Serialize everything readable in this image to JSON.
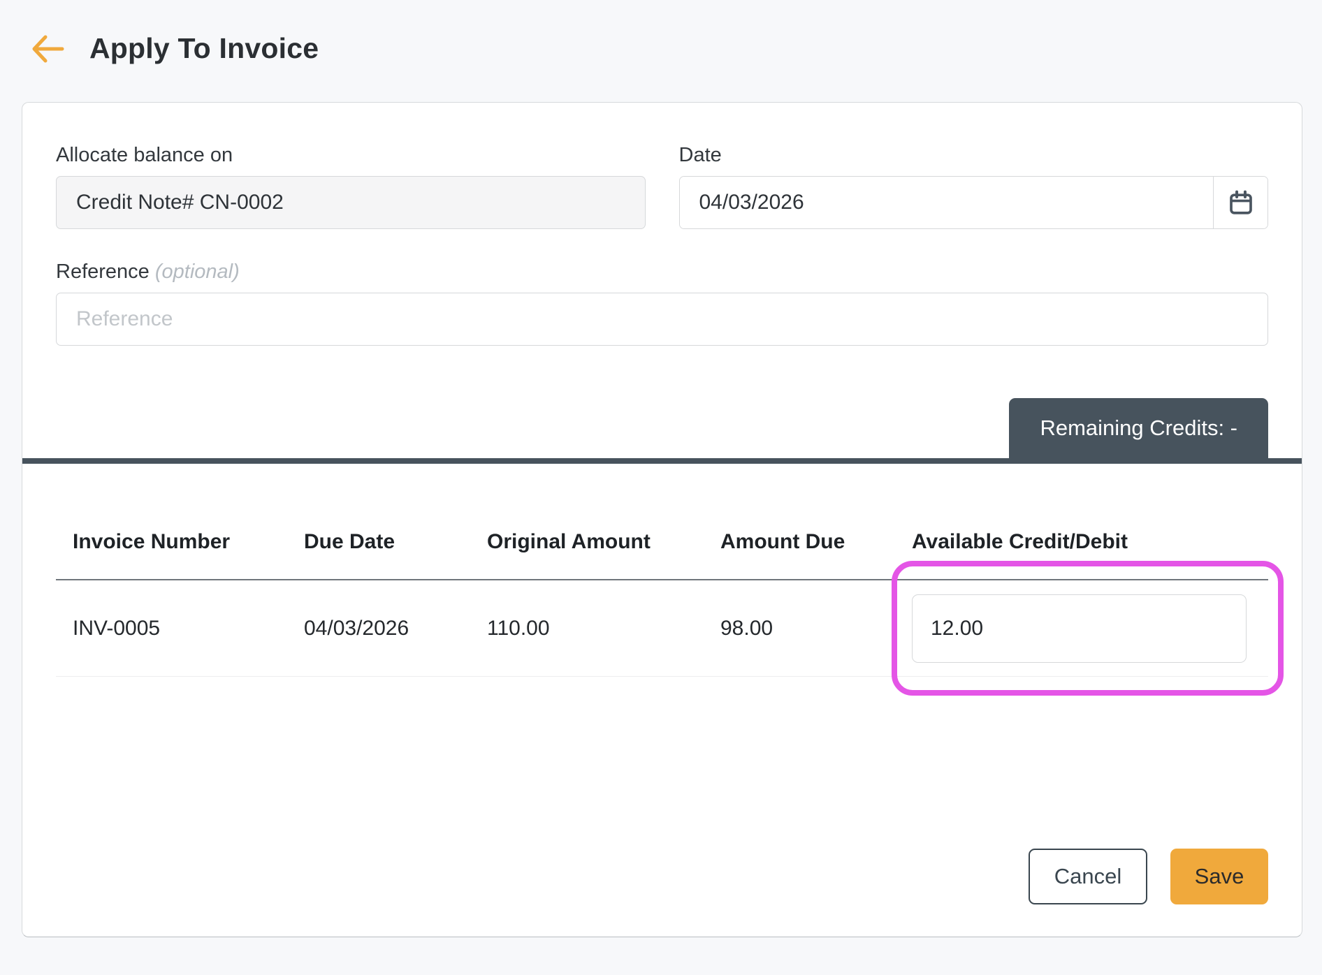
{
  "header": {
    "title": "Apply To Invoice"
  },
  "form": {
    "allocate": {
      "label": "Allocate balance on",
      "value": "Credit Note# CN-0002"
    },
    "date": {
      "label": "Date",
      "value": "04/03/2026"
    },
    "reference": {
      "label": "Reference",
      "optional_label": "(optional)",
      "placeholder": "Reference",
      "value": ""
    }
  },
  "credits_badge": {
    "label": "Remaining Credits: -"
  },
  "table": {
    "columns": [
      "Invoice Number",
      "Due Date",
      "Original Amount",
      "Amount Due",
      "Available Credit/Debit"
    ],
    "rows": [
      {
        "invoice_number": "INV-0005",
        "due_date": "04/03/2026",
        "original_amount": "110.00",
        "amount_due": "98.00",
        "available_credit": "12.00"
      }
    ]
  },
  "actions": {
    "cancel_label": "Cancel",
    "save_label": "Save"
  },
  "icons": {
    "back": "arrow-left-icon",
    "calendar": "calendar-icon"
  },
  "colors": {
    "accent_orange": "#F0A93C",
    "slate": "#47535D",
    "highlight_pink": "#E455E6",
    "page_bg": "#F7F8FA"
  }
}
